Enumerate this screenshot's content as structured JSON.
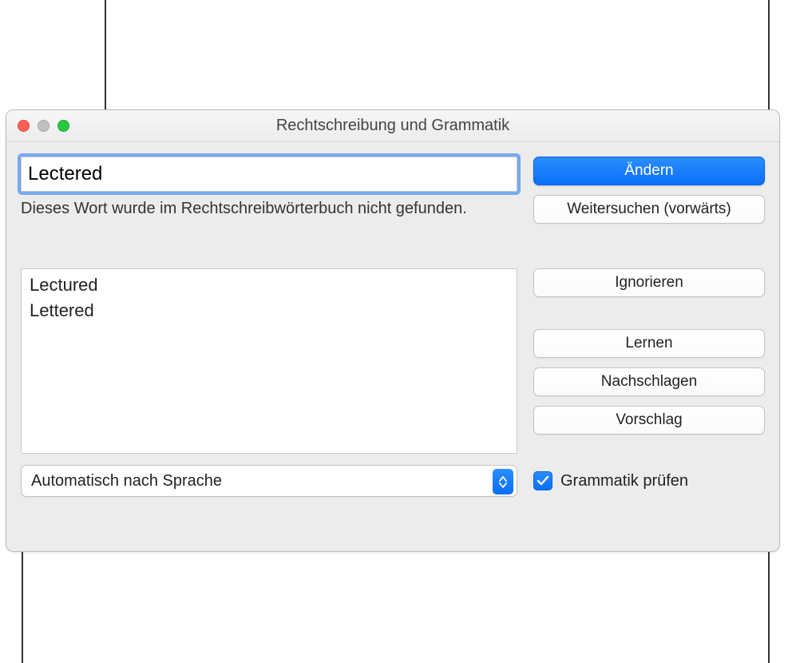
{
  "window": {
    "title": "Rechtschreibung und Grammatik"
  },
  "input": {
    "value": "Lectered"
  },
  "status": "Dieses Wort wurde im Rechtschreibwörterbuch nicht gefunden.",
  "buttons": {
    "change": "Ändern",
    "find_next": "Weitersuchen (vorwärts)",
    "ignore": "Ignorieren",
    "learn": "Lernen",
    "lookup": "Nachschlagen",
    "suggest": "Vorschlag"
  },
  "suggestions": [
    "Lectured",
    "Lettered"
  ],
  "language": {
    "selected": "Automatisch nach Sprache"
  },
  "checkbox": {
    "grammar_label": "Grammatik prüfen",
    "grammar_checked": true
  }
}
